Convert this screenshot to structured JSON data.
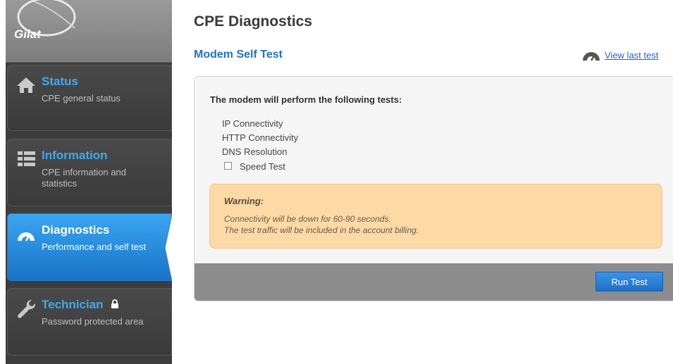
{
  "brand": {
    "logo": "Gilat"
  },
  "sidebar": {
    "items": [
      {
        "title": "Status",
        "subtitle": "CPE general status",
        "icon": "home-icon"
      },
      {
        "title": "Information",
        "subtitle": "CPE information and statistics",
        "icon": "list-icon"
      },
      {
        "title": "Diagnostics",
        "subtitle": "Performance and self test",
        "icon": "gauge-icon",
        "active": true
      },
      {
        "title": "Technician",
        "subtitle": "Password protected area",
        "icon": "wrench-icon",
        "locked": true
      }
    ]
  },
  "main": {
    "title": "CPE Diagnostics",
    "section_title": "Modem Self Test",
    "view_last_test": "View last test",
    "intro": "The modem will perform the following tests:",
    "tests": [
      "IP Connectivity",
      "HTTP Connectivity",
      "DNS Resolution"
    ],
    "speed_test_label": "Speed Test",
    "speed_test_checked": false,
    "warning": {
      "title": "Warning:",
      "lines": [
        "Connectivity will be down for 60-90 seconds.",
        "The test traffic will be included in the account billing."
      ]
    },
    "run_button": "Run Test"
  },
  "colors": {
    "accent": "#1e73c8",
    "nav_title": "#3eaaf1",
    "warning_bg": "#fdd9a5"
  }
}
